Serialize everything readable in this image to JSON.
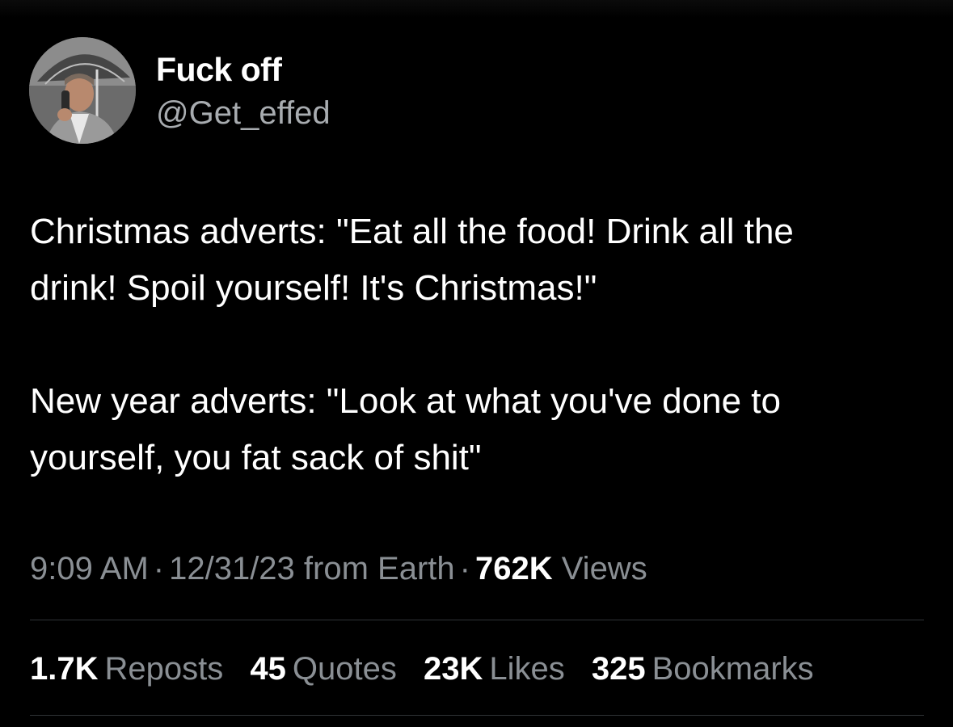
{
  "author": {
    "display_name": "Fuck off",
    "handle": "@Get_effed",
    "avatar_icon": "profile-photo-man-with-umbrella-and-phone"
  },
  "tweet": {
    "paragraph_1_line_1": "Christmas adverts: \"Eat all the food! Drink all the",
    "paragraph_1_line_2": "drink! Spoil yourself! It's Christmas!\"",
    "paragraph_2_line_1": "New year adverts: \"Look at what you've done to",
    "paragraph_2_line_2": "yourself, you fat sack of shit\""
  },
  "meta": {
    "time": "9:09 AM",
    "date": "12/31/23",
    "source": "from Earth",
    "views_count": "762K",
    "views_label": "Views",
    "separator": "·"
  },
  "stats": {
    "reposts_count": "1.7K",
    "reposts_label": "Reposts",
    "quotes_count": "45",
    "quotes_label": "Quotes",
    "likes_count": "23K",
    "likes_label": "Likes",
    "bookmarks_count": "325",
    "bookmarks_label": "Bookmarks"
  },
  "colors": {
    "background": "#000000",
    "primary_text": "#ffffff",
    "secondary_text": "#8a8f94",
    "divider": "#2f3336"
  }
}
